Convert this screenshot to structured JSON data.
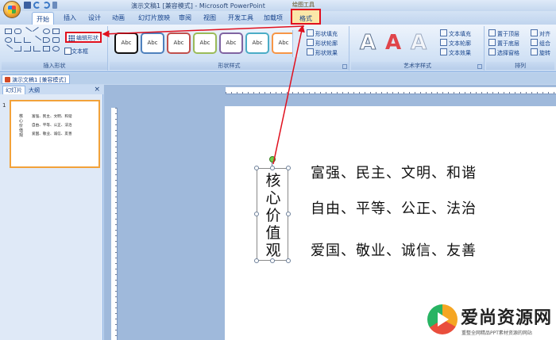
{
  "window": {
    "title": "演示文稿1 [兼容模式] - Microsoft PowerPoint",
    "context_label": "绘图工具"
  },
  "tabs": [
    "开始",
    "插入",
    "设计",
    "动画",
    "幻灯片放映",
    "审阅",
    "视图",
    "开发工具",
    "加载项"
  ],
  "format_tab": "格式",
  "ribbon": {
    "insert_shapes": {
      "label": "插入形状",
      "edit_shape": "编辑形状",
      "text_box": "文本框"
    },
    "shape_styles": {
      "label": "形状样式",
      "gallery_item": "Abc",
      "fill": "形状填充",
      "outline": "形状轮廓",
      "effects": "形状效果",
      "gallery_colors": [
        "#222222",
        "#4f81bd",
        "#c0504d",
        "#9bbb59",
        "#8064a2",
        "#4bacc6",
        "#f79646"
      ]
    },
    "wordart_styles": {
      "label": "艺术字样式",
      "sample": "A",
      "text_fill": "文本填充",
      "text_outline": "文本轮廓",
      "text_effects": "文本效果"
    },
    "arrange": {
      "label": "排列",
      "bring_front": "置于顶层",
      "send_back": "置于底层",
      "selection_pane": "选择窗格",
      "align": "对齐",
      "group": "组合",
      "rotate": "旋转"
    }
  },
  "document_tab": "演示文稿1 [兼容模式]",
  "left_panel": {
    "tab_slides": "幻灯片",
    "tab_outline": "大纲",
    "close": "×",
    "slide_number": "1",
    "thumb_vertical": "核心价值观",
    "thumb_lines": [
      "富强、民主、文明、和谐",
      "自由、平等、公正、法治",
      "爱国、敬业、诚信、友善"
    ]
  },
  "slide": {
    "vertical_text": "核心价值观",
    "lines": [
      "富强、民主、文明、和谐",
      "自由、平等、公正、法治",
      "爱国、敬业、诚信、友善"
    ]
  },
  "watermark": {
    "title": "爱尚资源网",
    "subtitle": "重整全网精品PPT素材资源的网站"
  },
  "colors": {
    "highlight": "#e0101e",
    "ribbon_blue": "#15428b"
  }
}
